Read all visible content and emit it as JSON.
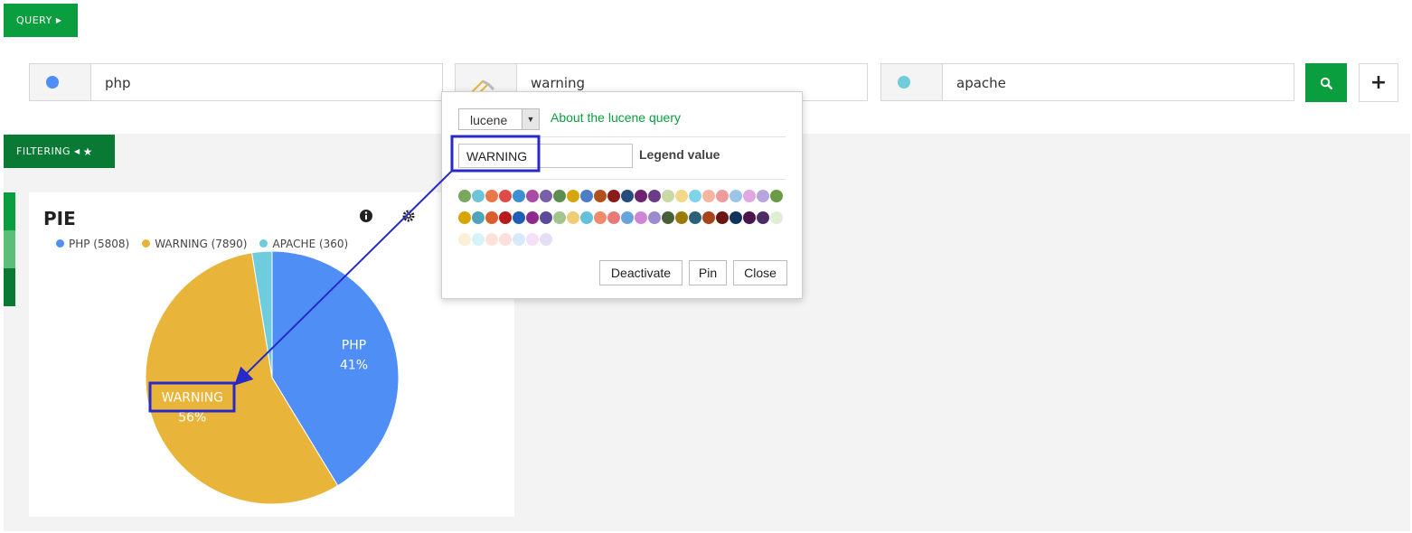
{
  "toolbar": {
    "query_label": "QUERY",
    "filtering_label": "FILTERING"
  },
  "queries": [
    {
      "text": "php",
      "color": "#4f8ef5"
    },
    {
      "text": "warning",
      "color": "#e8b53a"
    },
    {
      "text": "apache",
      "color": "#6fccdd"
    }
  ],
  "popover": {
    "query_type": "lucene",
    "about_link": "About the lucene query",
    "legend_value": "WARNING",
    "legend_label": "Legend value",
    "swatch_colors": [
      "#7aa75e",
      "#6cc6d8",
      "#e8774a",
      "#df4b49",
      "#3d8fd1",
      "#a94ba5",
      "#7a5fa8",
      "#5d8e4f",
      "#d6a60f",
      "#4c7ec5",
      "#b0501c",
      "#8b1c1c",
      "#244d7e",
      "#6e2371",
      "#6b3c8a",
      "#c8d9a5",
      "#f2d98a",
      "#7fd3e6",
      "#f6b7a0",
      "#ec9c9c",
      "#9cc4e9",
      "#e1a7e2",
      "#b7a6de",
      "#6a9c46",
      "#d9a400",
      "#4fa4bb",
      "#d95f2c",
      "#b71c1c",
      "#1e5eb4",
      "#8e2a8e",
      "#5e4a9a",
      "#a3c48b",
      "#efcd76",
      "#65c1db",
      "#ef8a6b",
      "#e87a7a",
      "#6aa4dd",
      "#cf85d6",
      "#9a8ad0",
      "#47603a",
      "#9a7b0a",
      "#2d6178",
      "#a8431c",
      "#6b1414",
      "#0f335c",
      "#4a154d",
      "#4d2c66",
      "#dfeed4",
      "#fcefd7",
      "#d7f3fa",
      "#fde2d9",
      "#fbdede",
      "#d7e9fa",
      "#f6e0f7",
      "#e4def6"
    ],
    "deactivate_label": "Deactivate",
    "pin_label": "Pin",
    "close_label": "Close"
  },
  "panel": {
    "title": "PIE",
    "info_icon": "info-circle-icon",
    "settings_icon": "gear-icon"
  },
  "chart_data": {
    "type": "pie",
    "title": "PIE",
    "series": [
      {
        "name": "PHP",
        "value": 5808,
        "legend": "PHP (5808)",
        "label": "PHP",
        "percent": "41%",
        "color": "#4f8ef5"
      },
      {
        "name": "WARNING",
        "value": 7890,
        "legend": "WARNING (7890)",
        "label": "WARNING",
        "percent": "56%",
        "color": "#e8b53a"
      },
      {
        "name": "APACHE",
        "value": 360,
        "legend": "APACHE (360)",
        "label": "",
        "percent": "",
        "color": "#6fccdd"
      }
    ]
  },
  "colors": {
    "accent": "#0a9e3f",
    "annotation": "#2929c8"
  }
}
